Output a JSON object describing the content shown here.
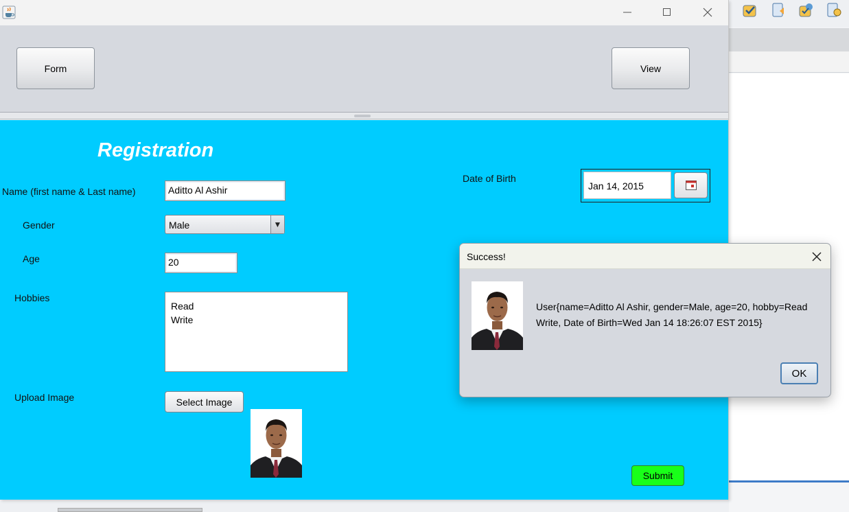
{
  "window": {
    "icon": "java-cup-icon",
    "controls": [
      "minimize-icon",
      "maximize-icon",
      "close-icon"
    ]
  },
  "nav": {
    "form_label": "Form",
    "view_label": "View"
  },
  "form": {
    "heading": "Registration",
    "name_label": "Name (first name & Last name)",
    "name_value": "Aditto Al Ashir",
    "gender_label": "Gender",
    "gender_value": "Male",
    "age_label": "Age",
    "age_value": "20",
    "hobbies_label": "Hobbies",
    "hobbies": [
      "Read",
      "Write"
    ],
    "upload_label": "Upload Image",
    "select_image_label": "Select Image",
    "dob_label": "Date of Birth",
    "dob_value": "Jan 14, 2015",
    "submit_label": "Submit"
  },
  "dialog": {
    "title": "Success!",
    "message": "User{name=Aditto Al Ashir, gender=Male, age=20, hobby=Read Write, Date of Birth=Wed Jan 14 18:26:07 EST 2015}",
    "ok_label": "OK"
  },
  "colors": {
    "form_bg": "#00ccff",
    "top_panel": "#d6d9df",
    "submit_bg": "#19ff19",
    "heading": "#ffffff"
  },
  "ide_toolbar_icons": [
    "build-icon",
    "open-project-icon",
    "run-icon",
    "debug-icon"
  ]
}
